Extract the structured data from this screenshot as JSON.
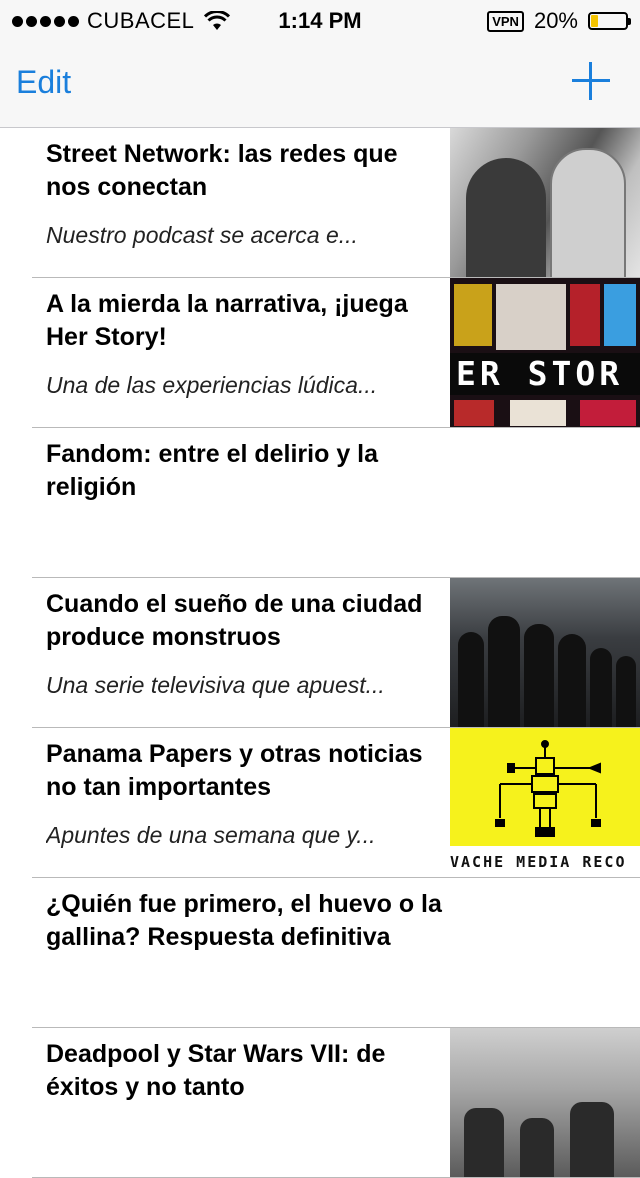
{
  "status_bar": {
    "carrier": "CUBACEL",
    "time": "1:14 PM",
    "vpn": "VPN",
    "battery": "20%",
    "battery_level": 0.2,
    "battery_color": "#f5c400"
  },
  "nav": {
    "edit_label": "Edit",
    "add_icon": "plus-icon",
    "accent_color": "#1a7fdc"
  },
  "articles": [
    {
      "title": "Street Network: las redes que nos conectan",
      "summary": "Nuestro podcast se acerca e..."
    },
    {
      "title": "A la mierda la narrativa, ¡juega Her Story!",
      "summary": "Una de las experiencias lúdica...",
      "thumb_text": "ER STOR"
    },
    {
      "title": "Fandom: entre el delirio y la religión",
      "summary": ""
    },
    {
      "title": "Cuando el sueño de una ciudad produce monstruos",
      "summary": "Una serie televisiva que apuest..."
    },
    {
      "title": "Panama Papers y otras noticias no tan importantes",
      "summary": "Apuntes de una semana que y...",
      "thumb_text": "VACHE MEDIA RECO"
    },
    {
      "title": "¿Quién fue primero, el huevo o la gallina? Respuesta definitiva",
      "summary": ""
    },
    {
      "title": "Deadpool y Star Wars VII: de éxitos y no tanto",
      "summary": ""
    }
  ]
}
